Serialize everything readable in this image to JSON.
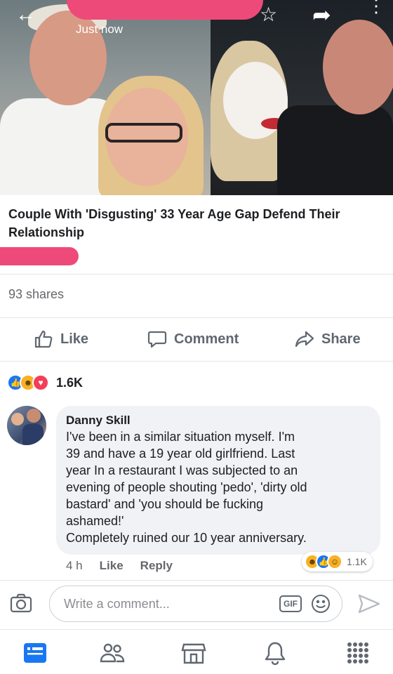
{
  "header": {
    "timestamp": "Just now",
    "back_icon": "back-arrow-icon",
    "star_icon": "star-icon",
    "share_icon": "share-arrow-icon",
    "more_icon": "more-vertical-icon"
  },
  "link_preview": {
    "headline": "Couple With 'Disgusting' 33 Year Age Gap Defend Their Relationship"
  },
  "post": {
    "shares": "93 shares",
    "reaction_count": "1.6K"
  },
  "actions": {
    "like": "Like",
    "comment": "Comment",
    "share": "Share"
  },
  "comment": {
    "author": "Danny Skill",
    "text": "I've been in a similar situation  myself. I'm\n39 and have a 19 year old girlfriend. Last\nyear In a restaurant I was subjected to an\nevening of people shouting 'pedo', 'dirty old\nbastard' and 'you should be fucking\nashamed!'\nCompletely ruined our 10 year anniversary.",
    "time": "4 h",
    "like": "Like",
    "reply": "Reply",
    "reaction_count": "1.1K"
  },
  "composer": {
    "placeholder": "Write a comment...",
    "gif_label": "GIF"
  },
  "colors": {
    "fb_blue": "#1877f2",
    "redaction_pink": "#ee4a79",
    "text_gray": "#65676b"
  }
}
